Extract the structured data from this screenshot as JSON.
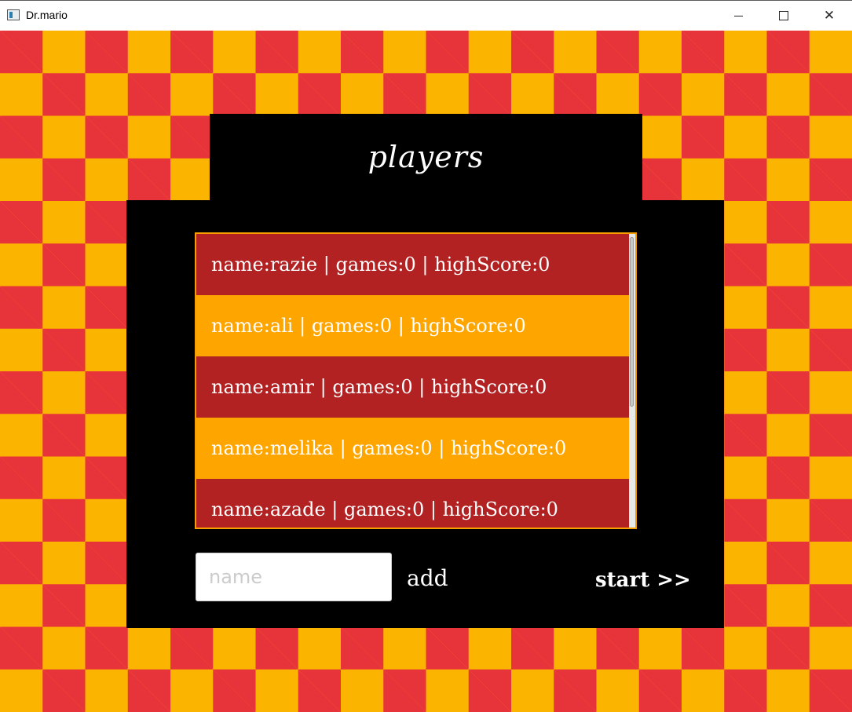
{
  "window": {
    "title": "Dr.mario",
    "minimize_icon": "minimize-icon",
    "maximize_icon": "maximize-icon",
    "close_icon": "close-icon",
    "close_glyph": "✕"
  },
  "colors": {
    "checker_red": "#e7333a",
    "checker_yellow": "#fbb400",
    "row_red": "#b22222",
    "row_orange": "#ffa500",
    "panel": "#000000"
  },
  "players_panel": {
    "title": "players",
    "rows": [
      {
        "label": "name:razie | games:0 | highScore:0",
        "color": "red"
      },
      {
        "label": "name:ali | games:0 | highScore:0",
        "color": "orange"
      },
      {
        "label": "name:amir | games:0 | highScore:0",
        "color": "red"
      },
      {
        "label": "name:melika | games:0 | highScore:0",
        "color": "orange"
      },
      {
        "label": "name:azade | games:0 | highScore:0",
        "color": "red"
      }
    ]
  },
  "controls": {
    "name_placeholder": "name",
    "name_value": "",
    "add_label": "add",
    "start_label": "start >>"
  }
}
